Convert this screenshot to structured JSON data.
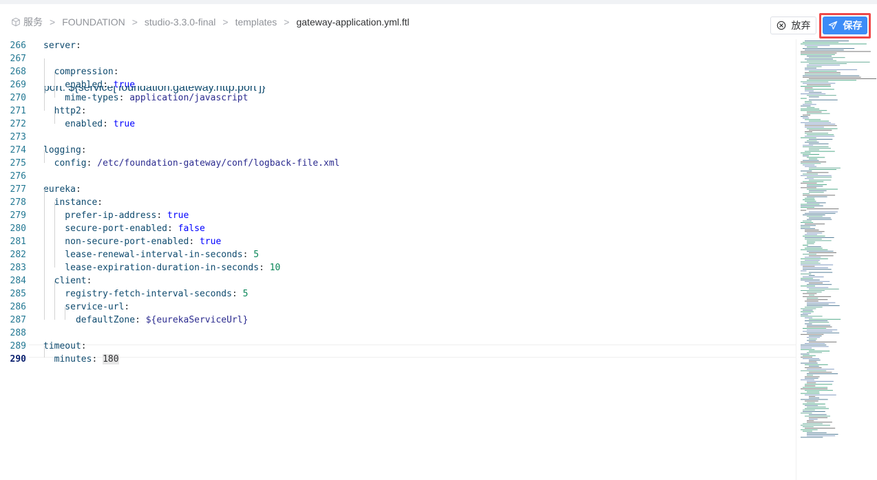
{
  "breadcrumb": {
    "items": [
      "服务",
      "FOUNDATION",
      "studio-3.3.0-final",
      "templates",
      "gateway-application.yml.ftl"
    ],
    "separator": ">"
  },
  "toolbar": {
    "discard_label": "放弃",
    "save_label": "保存"
  },
  "editor": {
    "partial_line": "port: ${service['foundation.gateway.http.port']}",
    "lines": [
      {
        "n": "266",
        "parts": [
          [
            "key",
            "server"
          ],
          [
            "punct",
            ":"
          ]
        ]
      },
      {
        "n": "267",
        "parts": []
      },
      {
        "n": "268",
        "parts": [
          [
            "key",
            "  compression"
          ],
          [
            "punct",
            ":"
          ]
        ]
      },
      {
        "n": "269",
        "parts": [
          [
            "key",
            "    enabled"
          ],
          [
            "punct",
            ": "
          ],
          [
            "bool",
            "true"
          ]
        ]
      },
      {
        "n": "270",
        "parts": [
          [
            "key",
            "    mime-types"
          ],
          [
            "punct",
            ": "
          ],
          [
            "str",
            "application/javascript"
          ]
        ]
      },
      {
        "n": "271",
        "parts": [
          [
            "key",
            "  http2"
          ],
          [
            "punct",
            ":"
          ]
        ]
      },
      {
        "n": "272",
        "parts": [
          [
            "key",
            "    enabled"
          ],
          [
            "punct",
            ": "
          ],
          [
            "bool",
            "true"
          ]
        ]
      },
      {
        "n": "273",
        "parts": []
      },
      {
        "n": "274",
        "parts": [
          [
            "key",
            "logging"
          ],
          [
            "punct",
            ":"
          ]
        ]
      },
      {
        "n": "275",
        "parts": [
          [
            "key",
            "  config"
          ],
          [
            "punct",
            ": "
          ],
          [
            "str",
            "/etc/foundation-gateway/conf/logback-file.xml"
          ]
        ]
      },
      {
        "n": "276",
        "parts": []
      },
      {
        "n": "277",
        "parts": [
          [
            "key",
            "eureka"
          ],
          [
            "punct",
            ":"
          ]
        ]
      },
      {
        "n": "278",
        "parts": [
          [
            "key",
            "  instance"
          ],
          [
            "punct",
            ":"
          ]
        ]
      },
      {
        "n": "279",
        "parts": [
          [
            "key",
            "    prefer-ip-address"
          ],
          [
            "punct",
            ": "
          ],
          [
            "bool",
            "true"
          ]
        ]
      },
      {
        "n": "280",
        "parts": [
          [
            "key",
            "    secure-port-enabled"
          ],
          [
            "punct",
            ": "
          ],
          [
            "bool",
            "false"
          ]
        ]
      },
      {
        "n": "281",
        "parts": [
          [
            "key",
            "    non-secure-port-enabled"
          ],
          [
            "punct",
            ": "
          ],
          [
            "bool",
            "true"
          ]
        ]
      },
      {
        "n": "282",
        "parts": [
          [
            "key",
            "    lease-renewal-interval-in-seconds"
          ],
          [
            "punct",
            ": "
          ],
          [
            "num",
            "5"
          ]
        ]
      },
      {
        "n": "283",
        "parts": [
          [
            "key",
            "    lease-expiration-duration-in-seconds"
          ],
          [
            "punct",
            ": "
          ],
          [
            "num",
            "10"
          ]
        ]
      },
      {
        "n": "284",
        "parts": [
          [
            "key",
            "  client"
          ],
          [
            "punct",
            ":"
          ]
        ]
      },
      {
        "n": "285",
        "parts": [
          [
            "key",
            "    registry-fetch-interval-seconds"
          ],
          [
            "punct",
            ": "
          ],
          [
            "num",
            "5"
          ]
        ]
      },
      {
        "n": "286",
        "parts": [
          [
            "key",
            "    service-url"
          ],
          [
            "punct",
            ":"
          ]
        ]
      },
      {
        "n": "287",
        "parts": [
          [
            "key",
            "      defaultZone"
          ],
          [
            "punct",
            ": "
          ],
          [
            "str",
            "${eurekaServiceUrl}"
          ]
        ]
      },
      {
        "n": "288",
        "parts": []
      },
      {
        "n": "289",
        "parts": [
          [
            "key",
            "timeout"
          ],
          [
            "punct",
            ":"
          ]
        ]
      },
      {
        "n": "290",
        "parts": [
          [
            "key",
            "  minutes"
          ],
          [
            "punct",
            ": "
          ],
          [
            "numhl",
            "180"
          ]
        ]
      }
    ],
    "active_line": "290"
  },
  "colors": {
    "accent": "#3c8cf7",
    "highlight_border": "#f04848",
    "line_number": "#237893",
    "key": "#0e4a6e",
    "boolean": "#0000ff",
    "number": "#098658"
  },
  "icons": {
    "breadcrumb": "cube-icon",
    "discard": "close-circle-icon",
    "save": "paper-plane-icon"
  }
}
